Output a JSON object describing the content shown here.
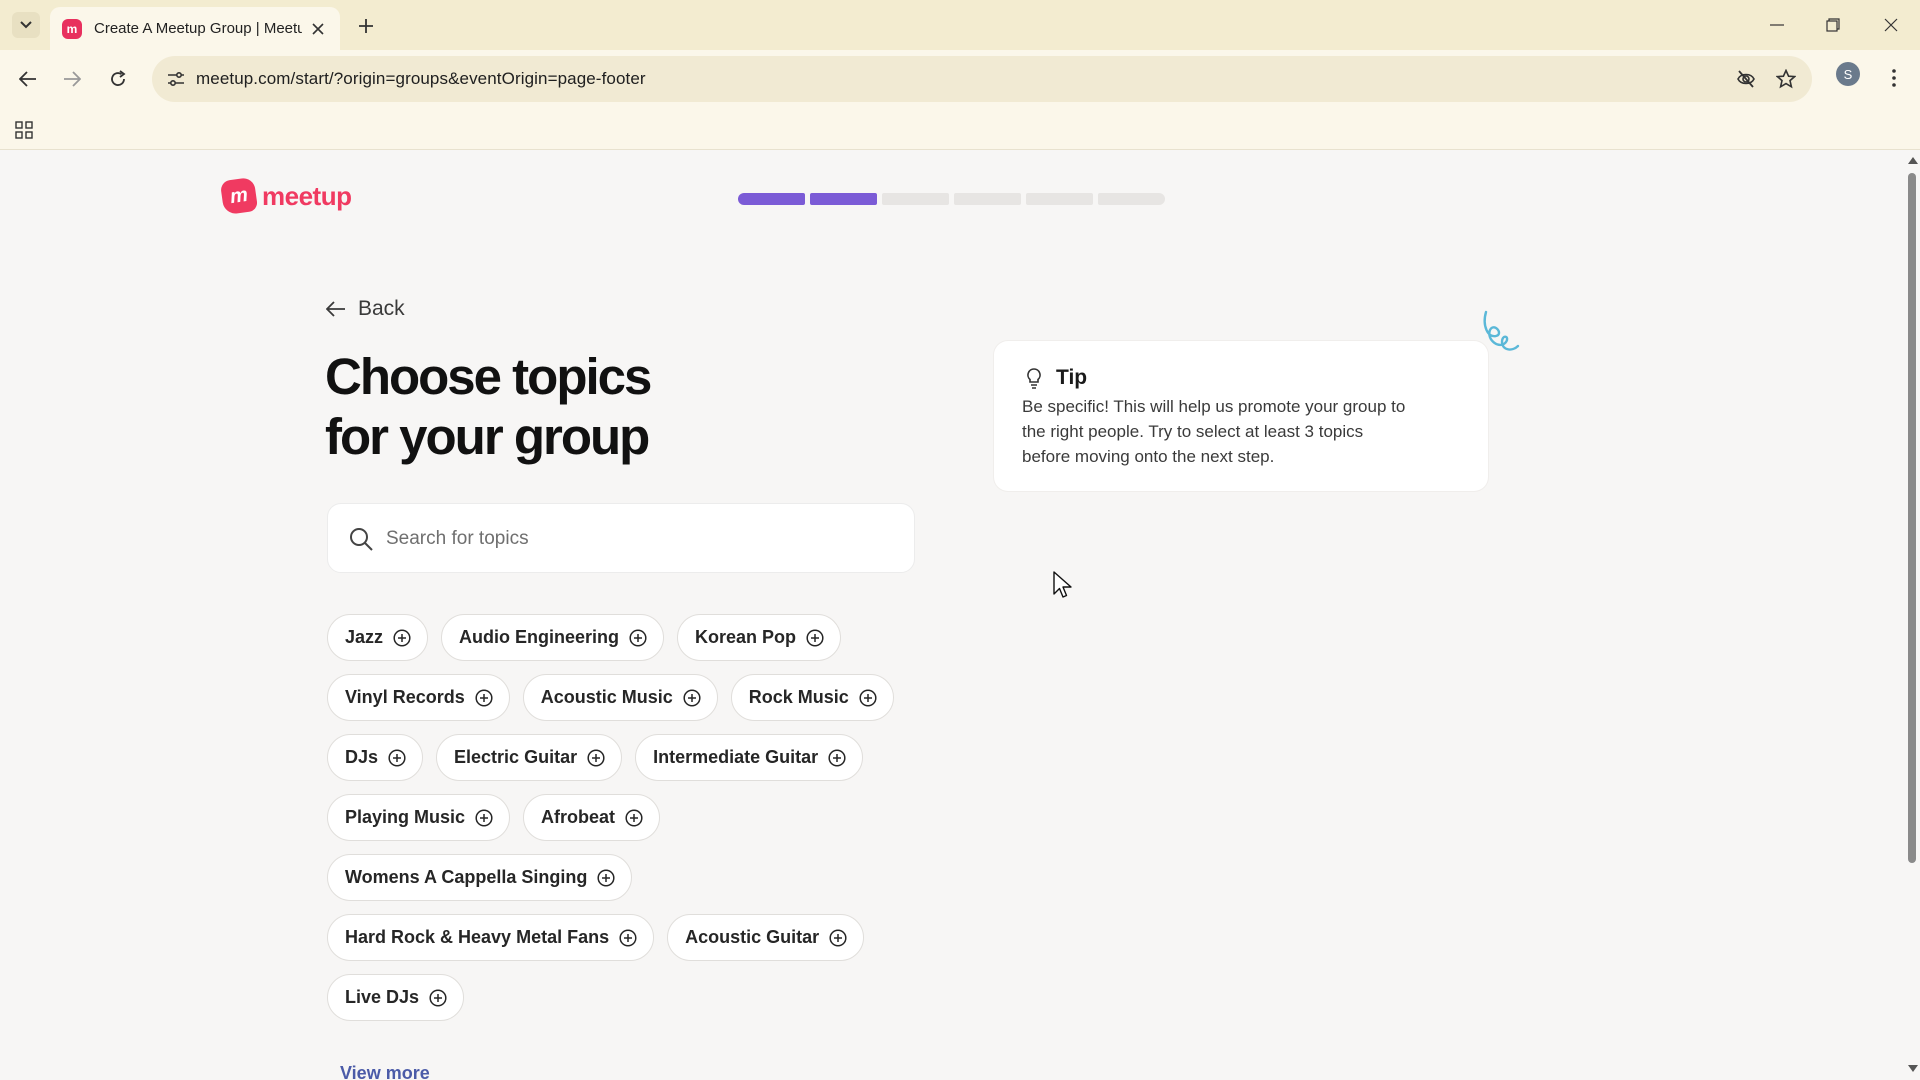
{
  "browser": {
    "tab_title": "Create A Meetup Group | Meetup",
    "favicon_letter": "m",
    "url": "meetup.com/start/?origin=groups&eventOrigin=page-footer",
    "profile_initial": "S"
  },
  "header": {
    "logo_text": "meetup",
    "logo_mark": "m",
    "progress": {
      "total_steps": 6,
      "completed_steps": 2
    }
  },
  "main": {
    "back_label": "Back",
    "title_line1": "Choose topics",
    "title_line2": "for your group",
    "search": {
      "placeholder": "Search for topics",
      "value": ""
    },
    "topic_rows": [
      [
        "Jazz",
        "Audio Engineering",
        "Korean Pop"
      ],
      [
        "Vinyl Records",
        "Acoustic Music",
        "Rock Music"
      ],
      [
        "DJs",
        "Electric Guitar",
        "Intermediate Guitar"
      ],
      [
        "Playing Music",
        "Afrobeat"
      ],
      [
        "Womens A Cappella Singing"
      ],
      [
        "Hard Rock & Heavy Metal Fans",
        "Acoustic Guitar"
      ],
      [
        "Live DJs"
      ]
    ],
    "view_more_label": "View more"
  },
  "tip": {
    "title": "Tip",
    "text": "Be specific! This will help us promote your group to the right people. Try to select at least 3 topics before moving onto the next step."
  },
  "colors": {
    "brand": "#f03a61",
    "progress_done": "#7b5bd6",
    "progress_todo": "#e7e5e3",
    "chrome_bg": "#f3ecd0",
    "link": "#4b5ba8",
    "squiggle": "#5bb8d8"
  },
  "icons": {
    "tab_dropdown": "chevron-down-icon",
    "tab_close": "close-icon",
    "new_tab": "plus-icon",
    "back": "arrow-left-icon",
    "forward": "arrow-right-icon",
    "reload": "reload-icon",
    "site_info": "tune-icon",
    "eye_off": "eye-off-icon",
    "bookmark": "star-icon",
    "menu": "kebab-menu-icon",
    "apps": "apps-grid-icon",
    "search": "search-icon",
    "topic_add": "plus-circle-icon",
    "tip": "lightbulb-icon"
  }
}
